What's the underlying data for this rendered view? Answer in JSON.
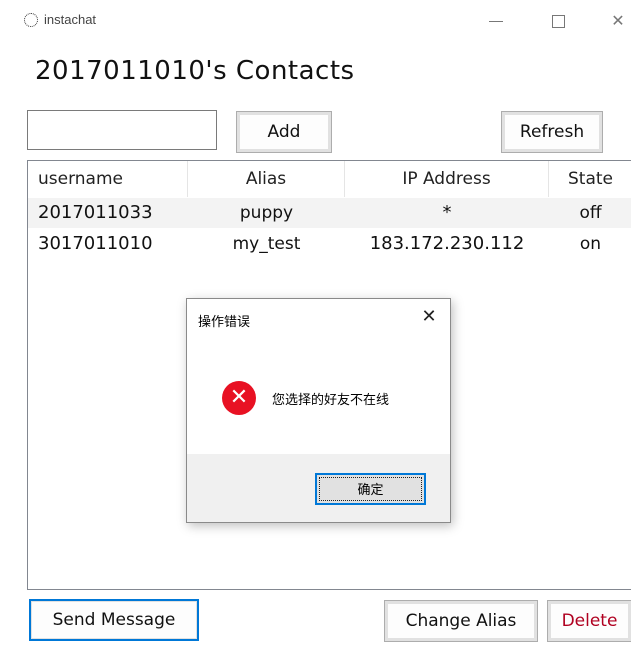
{
  "window": {
    "app_title": "instachat",
    "minimize_icon": "minimize-icon",
    "maximize_icon": "maximize-icon",
    "close_glyph": "✕"
  },
  "page": {
    "title": "2017011010's Contacts"
  },
  "toolbar": {
    "add_input_value": "",
    "add_label": "Add",
    "refresh_label": "Refresh"
  },
  "contacts": {
    "columns": [
      "username",
      "Alias",
      "IP Address",
      "State"
    ],
    "rows": [
      {
        "username": "2017011033",
        "alias": "puppy",
        "ip": "*",
        "state": "off"
      },
      {
        "username": "3017011010",
        "alias": "my_test",
        "ip": "183.172.230.112",
        "state": "on"
      }
    ]
  },
  "actions": {
    "send_label": "Send Message",
    "change_alias_label": "Change Alias",
    "delete_label": "Delete"
  },
  "dialog": {
    "title": "操作错误",
    "close_glyph": "✕",
    "icon": "error-icon",
    "icon_glyph": "✕",
    "message": "您选择的好友不在线",
    "ok_label": "确定"
  },
  "colors": {
    "accent": "#0078d7",
    "error": "#e81123",
    "delete_text": "#b00020"
  }
}
